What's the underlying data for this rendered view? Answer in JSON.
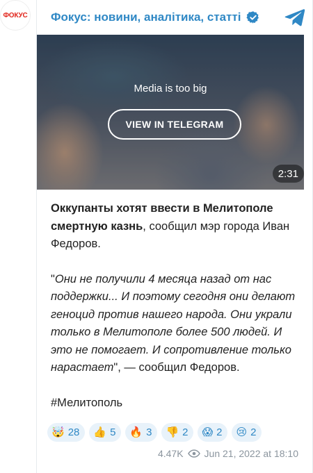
{
  "avatar": {
    "text": "ФОКУС"
  },
  "header": {
    "title": "Фокус: новини, аналітика, статті"
  },
  "media": {
    "message": "Media is too big",
    "button_label": "VIEW IN TELEGRAM",
    "duration": "2:31"
  },
  "post": {
    "bold_text": "Оккупанты хотят ввести в Мелитополе смертную казнь",
    "lead_rest": ", сообщил мэр города Иван Федоров.",
    "quote_open": "\"",
    "quote_text": "Они не получили 4 месяца назад от нас поддержки... И поэтому сегодня они делают геноцид против нашего народа. Они украли только в Мелитополе более 500 людей. И это не помогает. И сопротивление только нарастает",
    "quote_close": "\", — сообщил Федоров.",
    "hashtag": "#Мелитополь"
  },
  "reactions": [
    {
      "emoji": "🤯",
      "count": "28"
    },
    {
      "emoji": "👍",
      "count": "5"
    },
    {
      "emoji": "🔥",
      "count": "3"
    },
    {
      "emoji": "👎",
      "count": "2"
    },
    {
      "emoji": "😱",
      "count": "2"
    },
    {
      "emoji": "😢",
      "count": "2"
    }
  ],
  "footer": {
    "views": "4.47K",
    "date": "Jun 21, 2022 at 18:10"
  },
  "colors": {
    "accent": "#2f88c5",
    "brand_red": "#e1251b",
    "reaction_bg": "#e8f2fa"
  }
}
